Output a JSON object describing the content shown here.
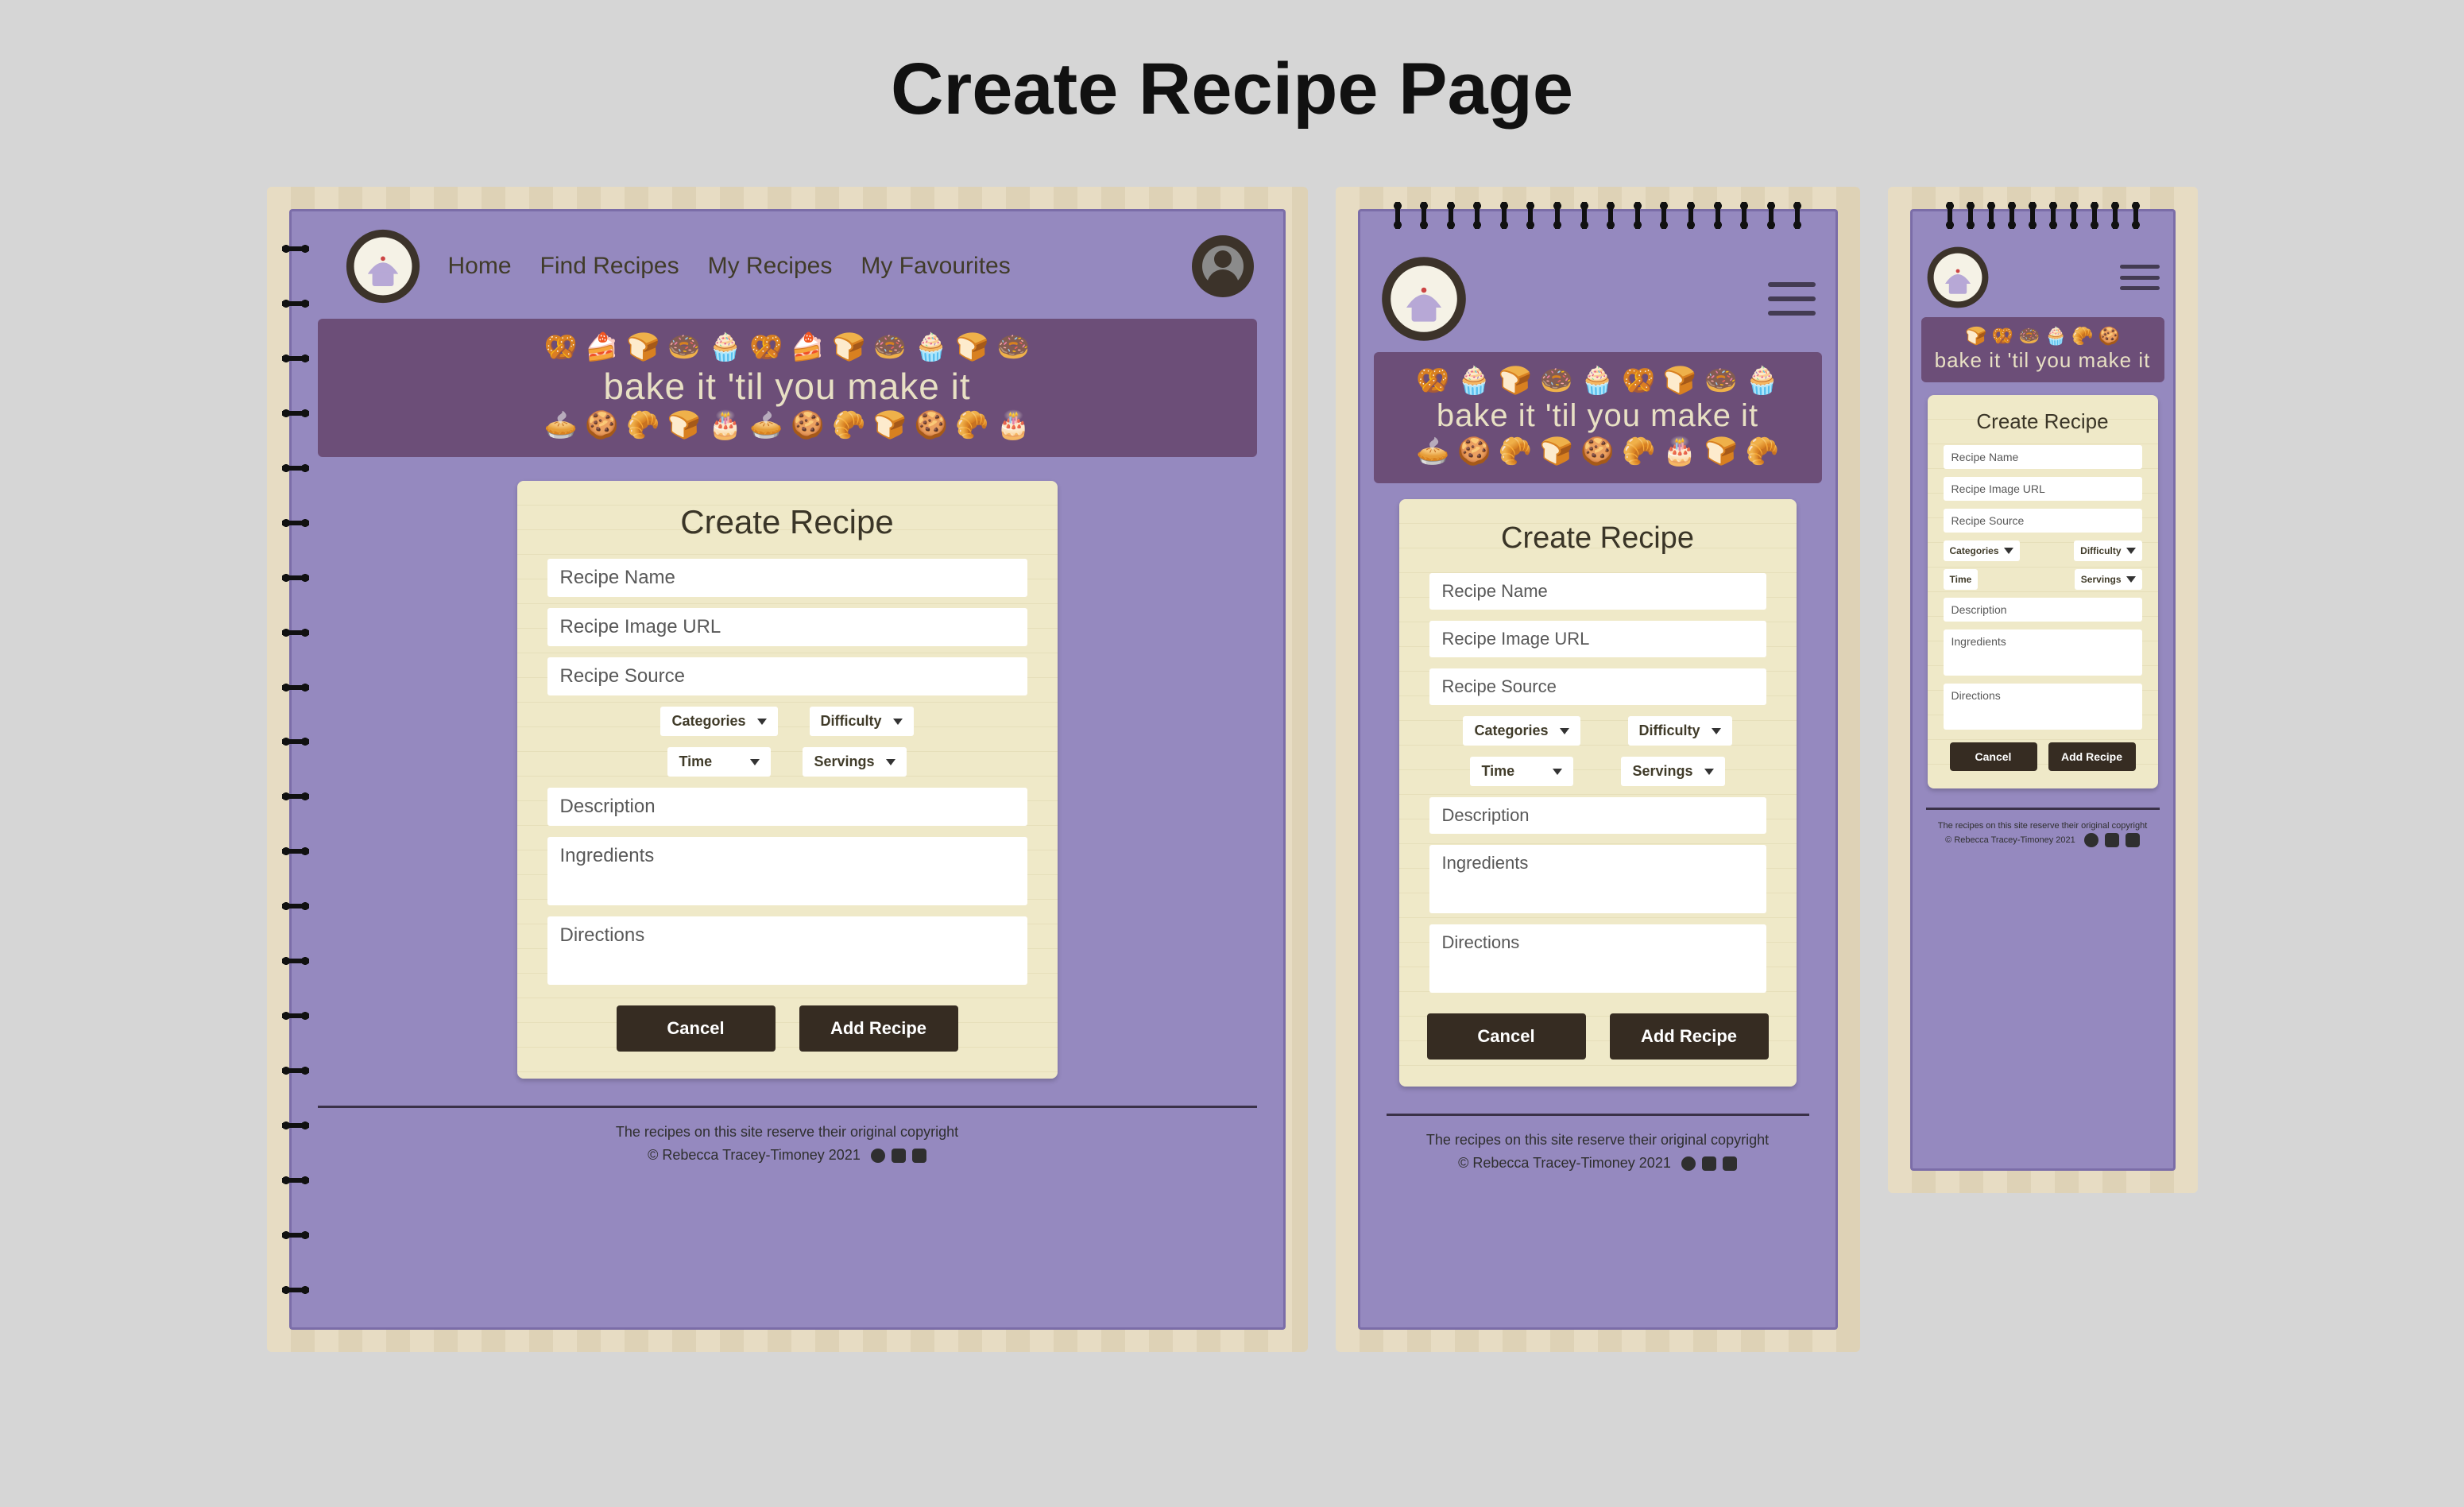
{
  "page_title": "Create Recipe Page",
  "logo_alt": "Make It Bake It",
  "nav": {
    "home": "Home",
    "find": "Find Recipes",
    "mine": "My Recipes",
    "favs": "My Favourites"
  },
  "banner": {
    "tagline": "bake it 'til you make it"
  },
  "form": {
    "heading": "Create Recipe",
    "recipe_name": "Recipe Name",
    "image_url": "Recipe Image URL",
    "source": "Recipe Source",
    "categories": "Categories",
    "difficulty": "Difficulty",
    "time": "Time",
    "servings": "Servings",
    "description": "Description",
    "ingredients": "Ingredients",
    "directions": "Directions",
    "cancel": "Cancel",
    "add": "Add Recipe"
  },
  "footer": {
    "disclaimer": "The recipes on this site reserve their original copyright",
    "credit": "© Rebecca Tracey-Timoney 2021"
  }
}
